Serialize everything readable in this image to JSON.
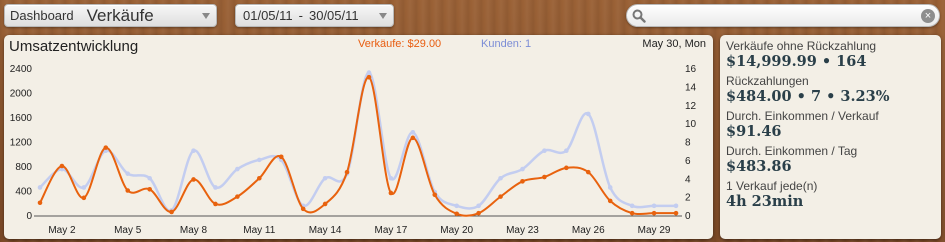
{
  "topbar": {
    "dashboard_label": "Dashboard",
    "dashboard_value": "Verkäufe",
    "date_from": "01/05/11",
    "date_sep": "-",
    "date_to": "30/05/11",
    "search_placeholder": "",
    "search_icon": "search-icon",
    "clear_icon": "clear-icon"
  },
  "chart_panel": {
    "title": "Umsatzentwicklung",
    "legend_sales": "Verkäufe: $29.00",
    "legend_customers": "Kunden: 1",
    "hover_date": "May 30, Mon"
  },
  "stats": [
    {
      "label": "Verkäufe ohne Rückzahlung",
      "value": "$14,999.99 • 164"
    },
    {
      "label": "Rückzahlungen",
      "value": "$484.00 • 7 • 3.23%"
    },
    {
      "label": "Durch. Einkommen / Verkauf",
      "value": "$91.46"
    },
    {
      "label": "Durch. Einkommen / Tag",
      "value": "$483.86"
    },
    {
      "label": "1 Verkauf jede(n)",
      "value": "4h 23min"
    }
  ],
  "chart_data": {
    "type": "line",
    "title": "Umsatzentwicklung",
    "xlabel": "",
    "ylabel": "",
    "x_tick_labels": [
      "May 2",
      "May 5",
      "May 8",
      "May 11",
      "May 14",
      "May 17",
      "May 20",
      "May 23",
      "May 26",
      "May 29"
    ],
    "x": [
      "May 1",
      "May 2",
      "May 3",
      "May 4",
      "May 5",
      "May 6",
      "May 7",
      "May 8",
      "May 9",
      "May 10",
      "May 11",
      "May 12",
      "May 13",
      "May 14",
      "May 15",
      "May 16",
      "May 17",
      "May 18",
      "May 19",
      "May 20",
      "May 21",
      "May 22",
      "May 23",
      "May 24",
      "May 25",
      "May 26",
      "May 27",
      "May 28",
      "May 29",
      "May 30"
    ],
    "y_left_ticks": [
      0,
      400,
      800,
      1200,
      1600,
      2000,
      2400
    ],
    "y_left_lim": [
      0,
      2400
    ],
    "y_right_ticks": [
      0,
      2,
      4,
      6,
      8,
      10,
      12,
      14,
      16
    ],
    "y_right_lim": [
      0,
      16
    ],
    "grid": false,
    "legend": "top",
    "series": [
      {
        "name": "Verkäufe",
        "axis": "left",
        "color": "#e8620e",
        "values": [
          200,
          800,
          280,
          1100,
          400,
          420,
          50,
          580,
          180,
          300,
          600,
          950,
          100,
          180,
          700,
          2250,
          360,
          1260,
          330,
          20,
          30,
          300,
          550,
          620,
          770,
          700,
          230,
          30,
          30,
          30
        ]
      },
      {
        "name": "Kunden",
        "axis": "right",
        "color": "#c3cdf0",
        "values": [
          3,
          5,
          3,
          7,
          4.5,
          4,
          0.5,
          7,
          3,
          5,
          6,
          6,
          1,
          4,
          4.5,
          15.5,
          4,
          9,
          2.5,
          1,
          1,
          4,
          5,
          7,
          7,
          11,
          3,
          1,
          1,
          1
        ]
      }
    ]
  }
}
